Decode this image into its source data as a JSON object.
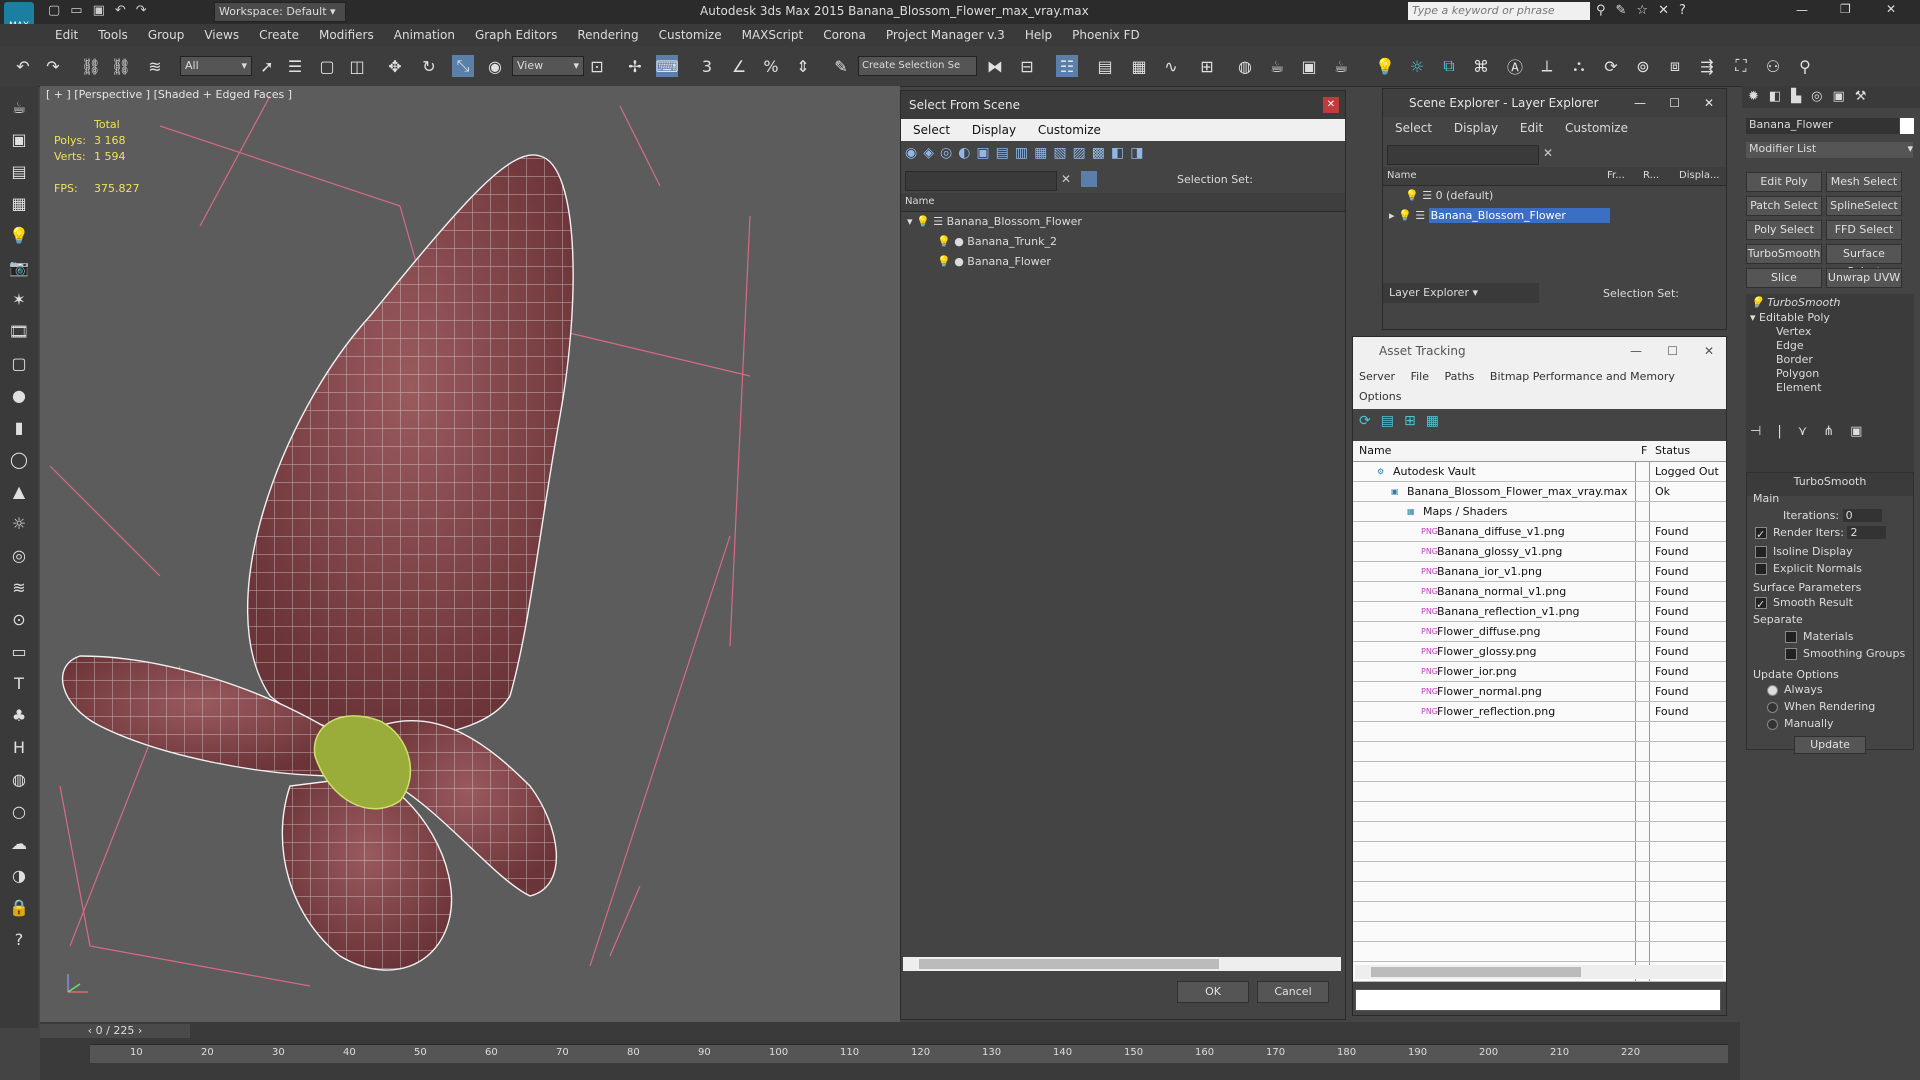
{
  "titlebar": {
    "app_title": "Autodesk 3ds Max  2015    Banana_Blossom_Flower_max_vray.max",
    "workspace": "Workspace: Default",
    "search_placeholder": "Type a keyword or phrase"
  },
  "menu": [
    "Edit",
    "Tools",
    "Group",
    "Views",
    "Create",
    "Modifiers",
    "Animation",
    "Graph Editors",
    "Rendering",
    "Customize",
    "MAXScript",
    "Corona",
    "Project Manager v.3",
    "Help",
    "Phoenix FD"
  ],
  "toolbar": {
    "filter": "All",
    "view": "View",
    "selection_set": "Create Selection Se"
  },
  "viewport": {
    "label": "[ + ] [Perspective ] [Shaded + Edged Faces ]",
    "stats_header": "Total",
    "polys_label": "Polys:",
    "polys_value": "3 168",
    "verts_label": "Verts:",
    "verts_value": "1 594",
    "fps_label": "FPS:",
    "fps_value": "375.827"
  },
  "select_from_scene": {
    "title": "Select From Scene",
    "menu": [
      "Select",
      "Display",
      "Customize"
    ],
    "selection_set": "Selection Set:",
    "col_name": "Name",
    "items": [
      "Banana_Blossom_Flower",
      "Banana_Trunk_2",
      "Banana_Flower"
    ],
    "ok": "OK",
    "cancel": "Cancel"
  },
  "scene_explorer": {
    "title": "Scene Explorer - Layer Explorer",
    "menu": [
      "Select",
      "Display",
      "Edit",
      "Customize"
    ],
    "cols": [
      "Name",
      "Fr...",
      "R...",
      "Displa..."
    ],
    "layers": [
      "0 (default)",
      "Banana_Blossom_Flower"
    ],
    "footer": "Layer Explorer",
    "selection_set": "Selection Set:"
  },
  "asset_tracking": {
    "title": "Asset Tracking",
    "menu": [
      "Server",
      "File",
      "Paths",
      "Bitmap Performance and Memory"
    ],
    "menu2": "Options",
    "col_name": "Name",
    "col_f": "F",
    "col_status": "Status",
    "rows": [
      {
        "name": "Autodesk Vault",
        "status": "Logged Out"
      },
      {
        "name": "Banana_Blossom_Flower_max_vray.max",
        "status": "Ok"
      },
      {
        "name": "Maps / Shaders",
        "status": ""
      },
      {
        "name": "Banana_diffuse_v1.png",
        "status": "Found"
      },
      {
        "name": "Banana_glossy_v1.png",
        "status": "Found"
      },
      {
        "name": "Banana_ior_v1.png",
        "status": "Found"
      },
      {
        "name": "Banana_normal_v1.png",
        "status": "Found"
      },
      {
        "name": "Banana_reflection_v1.png",
        "status": "Found"
      },
      {
        "name": "Flower_diffuse.png",
        "status": "Found"
      },
      {
        "name": "Flower_glossy.png",
        "status": "Found"
      },
      {
        "name": "Flower_ior.png",
        "status": "Found"
      },
      {
        "name": "Flower_normal.png",
        "status": "Found"
      },
      {
        "name": "Flower_reflection.png",
        "status": "Found"
      }
    ]
  },
  "command_panel": {
    "object_name": "Banana_Flower",
    "modifier_list": "Modifier List",
    "buttons": [
      "Edit Poly",
      "Mesh Select",
      "Patch Select",
      "SplineSelect",
      "Poly Select",
      "FFD Select",
      "TurboSmooth",
      "Surface Select",
      "Slice",
      "Unwrap UVW"
    ],
    "stack": [
      "TurboSmooth",
      "Editable Poly",
      "Vertex",
      "Edge",
      "Border",
      "Polygon",
      "Element"
    ],
    "rollout": "TurboSmooth",
    "main": "Main",
    "iterations_label": "Iterations:",
    "iterations": "0",
    "render_iters_label": "Render Iters:",
    "render_iters": "2",
    "isoline": "Isoline Display",
    "explicit": "Explicit Normals",
    "surface_params": "Surface Parameters",
    "smooth_result": "Smooth Result",
    "separate": "Separate",
    "materials": "Materials",
    "smoothing_groups": "Smoothing Groups",
    "update_options": "Update Options",
    "always": "Always",
    "when_rendering": "When Rendering",
    "manually": "Manually",
    "update": "Update"
  },
  "timeline": {
    "frame": "0 / 225",
    "ticks": [
      "10",
      "20",
      "30",
      "40",
      "50",
      "60",
      "70",
      "80",
      "90",
      "100",
      "110",
      "120",
      "130",
      "140",
      "150",
      "160",
      "170",
      "180",
      "190",
      "200",
      "210",
      "220"
    ]
  }
}
